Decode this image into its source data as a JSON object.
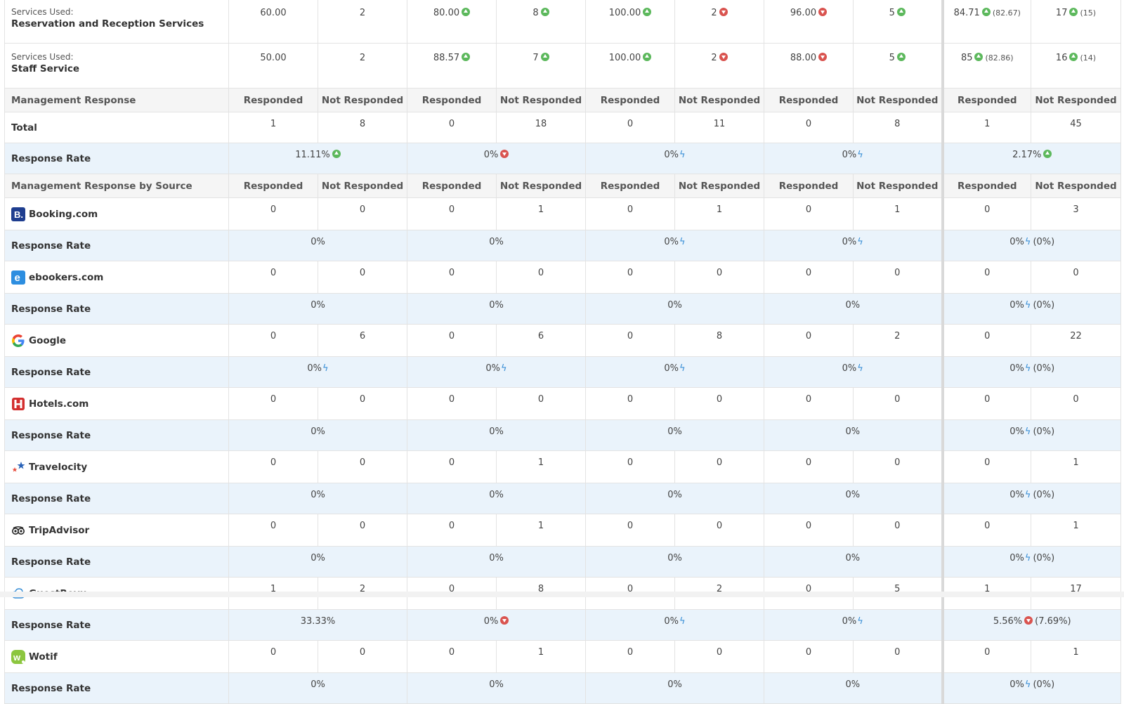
{
  "services": [
    {
      "small": "Services Used:",
      "name": "Reservation and Reception Services",
      "cells": [
        {
          "v": "60.00"
        },
        {
          "v": "2"
        },
        {
          "v": "80.00",
          "ic": "up"
        },
        {
          "v": "8",
          "ic": "up"
        },
        {
          "v": "100.00",
          "ic": "up"
        },
        {
          "v": "2",
          "ic": "dn"
        },
        {
          "v": "96.00",
          "ic": "dn"
        },
        {
          "v": "5",
          "ic": "up"
        },
        {
          "v": "84.71",
          "ic": "up",
          "ps": "(82.67)"
        },
        {
          "v": "17",
          "ic": "up",
          "ps": "(15)"
        }
      ]
    },
    {
      "small": "Services Used:",
      "name": "Staff Service",
      "cells": [
        {
          "v": "50.00"
        },
        {
          "v": "2"
        },
        {
          "v": "88.57",
          "ic": "up"
        },
        {
          "v": "7",
          "ic": "up"
        },
        {
          "v": "100.00",
          "ic": "up"
        },
        {
          "v": "2",
          "ic": "dn"
        },
        {
          "v": "88.00",
          "ic": "dn"
        },
        {
          "v": "5",
          "ic": "up"
        },
        {
          "v": "85",
          "ic": "up",
          "ps": "(82.86)"
        },
        {
          "v": "16",
          "ic": "up",
          "ps": "(14)"
        }
      ]
    }
  ],
  "mgmt": {
    "header_label": "Management Response",
    "responded": "Responded",
    "not_responded": "Not Responded",
    "total_label": "Total",
    "totals": [
      "1",
      "8",
      "0",
      "18",
      "0",
      "11",
      "0",
      "8",
      "1",
      "45"
    ],
    "rate_label": "Response Rate",
    "rates": [
      {
        "v": "11.11%",
        "ic": "up"
      },
      {
        "v": "0%",
        "ic": "dn"
      },
      {
        "v": "0%",
        "ic": "bolt"
      },
      {
        "v": "0%",
        "ic": "bolt"
      },
      {
        "v": "2.17%",
        "ic": "up"
      }
    ]
  },
  "by_source": {
    "header_label": "Management Response by Source",
    "rate_label": "Response Rate",
    "sources": [
      {
        "name": "Booking.com",
        "logo": "booking-logo",
        "vals": [
          "0",
          "0",
          "0",
          "1",
          "0",
          "1",
          "0",
          "1",
          "0",
          "3"
        ],
        "rates": [
          {
            "v": "0%"
          },
          {
            "v": "0%"
          },
          {
            "v": "0%",
            "ic": "bolt"
          },
          {
            "v": "0%",
            "ic": "bolt"
          },
          {
            "v": "0%",
            "ic": "bolt",
            "p": "(0%)"
          }
        ]
      },
      {
        "name": "ebookers.com",
        "logo": "ebookers-logo",
        "vals": [
          "0",
          "0",
          "0",
          "0",
          "0",
          "0",
          "0",
          "0",
          "0",
          "0"
        ],
        "rates": [
          {
            "v": "0%"
          },
          {
            "v": "0%"
          },
          {
            "v": "0%"
          },
          {
            "v": "0%"
          },
          {
            "v": "0%",
            "ic": "bolt",
            "p": "(0%)"
          }
        ]
      },
      {
        "name": "Google",
        "logo": "google-logo",
        "vals": [
          "0",
          "6",
          "0",
          "6",
          "0",
          "8",
          "0",
          "2",
          "0",
          "22"
        ],
        "rates": [
          {
            "v": "0%",
            "ic": "bolt"
          },
          {
            "v": "0%",
            "ic": "bolt"
          },
          {
            "v": "0%",
            "ic": "bolt"
          },
          {
            "v": "0%",
            "ic": "bolt"
          },
          {
            "v": "0%",
            "ic": "bolt",
            "p": "(0%)"
          }
        ]
      },
      {
        "name": "Hotels.com",
        "logo": "hotels-logo",
        "vals": [
          "0",
          "0",
          "0",
          "0",
          "0",
          "0",
          "0",
          "0",
          "0",
          "0"
        ],
        "rates": [
          {
            "v": "0%"
          },
          {
            "v": "0%"
          },
          {
            "v": "0%"
          },
          {
            "v": "0%"
          },
          {
            "v": "0%",
            "ic": "bolt",
            "p": "(0%)"
          }
        ]
      },
      {
        "name": "Travelocity",
        "logo": "travelocity-logo",
        "vals": [
          "0",
          "0",
          "0",
          "1",
          "0",
          "0",
          "0",
          "0",
          "0",
          "1"
        ],
        "rates": [
          {
            "v": "0%"
          },
          {
            "v": "0%"
          },
          {
            "v": "0%"
          },
          {
            "v": "0%"
          },
          {
            "v": "0%",
            "ic": "bolt",
            "p": "(0%)"
          }
        ]
      },
      {
        "name": "TripAdvisor",
        "logo": "tripadvisor-logo",
        "vals": [
          "0",
          "0",
          "0",
          "1",
          "0",
          "0",
          "0",
          "0",
          "0",
          "1"
        ],
        "rates": [
          {
            "v": "0%"
          },
          {
            "v": "0%"
          },
          {
            "v": "0%"
          },
          {
            "v": "0%"
          },
          {
            "v": "0%",
            "ic": "bolt",
            "p": "(0%)"
          }
        ]
      },
      {
        "name": "GuestRevu",
        "logo": "guestrevu-logo",
        "vals": [
          "1",
          "2",
          "0",
          "8",
          "0",
          "2",
          "0",
          "5",
          "1",
          "17"
        ],
        "rates": [
          {
            "v": "33.33%"
          },
          {
            "v": "0%",
            "ic": "dn"
          },
          {
            "v": "0%",
            "ic": "bolt"
          },
          {
            "v": "0%",
            "ic": "bolt"
          },
          {
            "v": "5.56%",
            "ic": "dn",
            "p": "(7.69%)"
          }
        ]
      },
      {
        "name": "Wotif",
        "logo": "wotif-logo",
        "vals": [
          "0",
          "0",
          "0",
          "1",
          "0",
          "0",
          "0",
          "0",
          "0",
          "1"
        ],
        "rates": [
          {
            "v": "0%"
          },
          {
            "v": "0%"
          },
          {
            "v": "0%"
          },
          {
            "v": "0%"
          },
          {
            "v": "0%",
            "ic": "bolt",
            "p": "(0%)"
          }
        ]
      }
    ]
  },
  "colors": {
    "up": "#5cb85c",
    "down": "#d9534f",
    "bolt": "#3a8fd6",
    "rate_row_bg": "#eaf3fb",
    "header_bg": "#f5f5f5"
  }
}
